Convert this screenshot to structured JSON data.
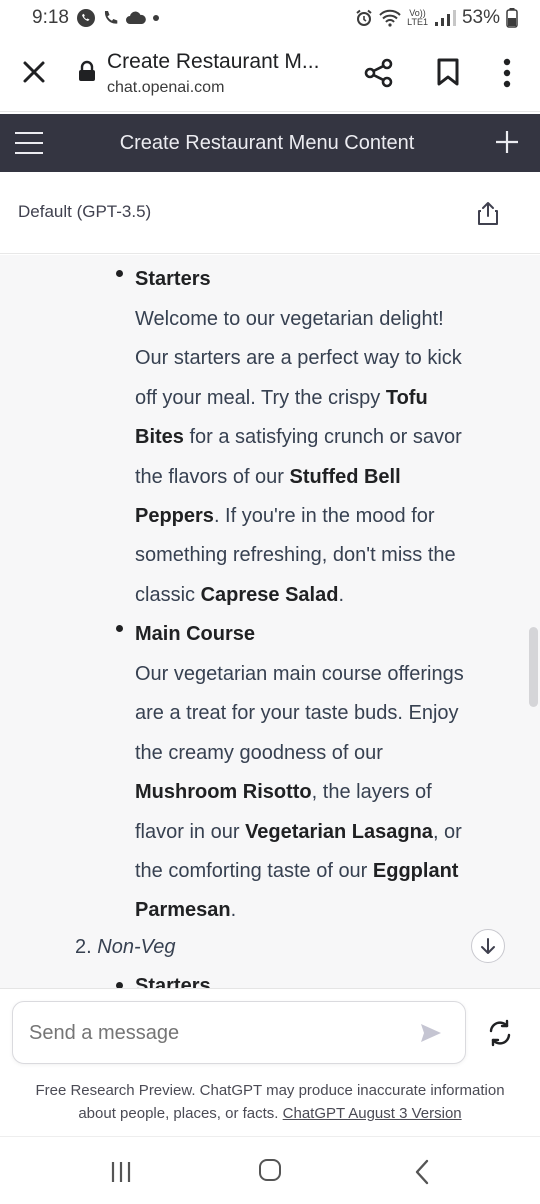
{
  "status_bar": {
    "time": "9:18",
    "battery": "53%",
    "network_top": "Vo))",
    "network_bottom": "LTE1"
  },
  "browser": {
    "title": "Create Restaurant M...",
    "url": "chat.openai.com"
  },
  "app_header": {
    "title": "Create Restaurant Menu Content"
  },
  "model": {
    "label": "Default (GPT-3.5)"
  },
  "conversation": {
    "starters": {
      "heading": "Starters",
      "lines": [
        "Welcome to our vegetarian delight!",
        "Our starters are a perfect way to kick",
        "off your meal. Try the crispy ",
        "Tofu",
        "Bites",
        " for a satisfying crunch or savor",
        "the flavors of our ",
        "Stuffed Bell",
        "Peppers",
        ". If you're in the mood for",
        "something refreshing, don't miss the",
        "classic ",
        "Caprese Salad",
        "."
      ]
    },
    "main_course": {
      "heading": "Main Course",
      "lines": [
        "Our vegetarian main course offerings",
        "are a treat for your taste buds. Enjoy",
        "the creamy goodness of our",
        "Mushroom Risotto",
        ", the layers of",
        "flavor in our ",
        "Vegetarian Lasagna",
        ", or",
        "the comforting taste of our ",
        "Eggplant",
        "Parmesan",
        "."
      ]
    },
    "numbered_item": {
      "number": "2.",
      "label": "Non-Veg"
    },
    "cut_off_heading": "Starters"
  },
  "input": {
    "placeholder": "Send a message"
  },
  "disclaimer": {
    "text_line1": "Free Research Preview. ChatGPT may produce inaccurate information",
    "text_line2": "about people, places, or facts. ",
    "link": "ChatGPT August 3 Version"
  },
  "colors": {
    "header_bg": "#343541",
    "content_bg": "#f7f7f8",
    "text": "#374151"
  }
}
